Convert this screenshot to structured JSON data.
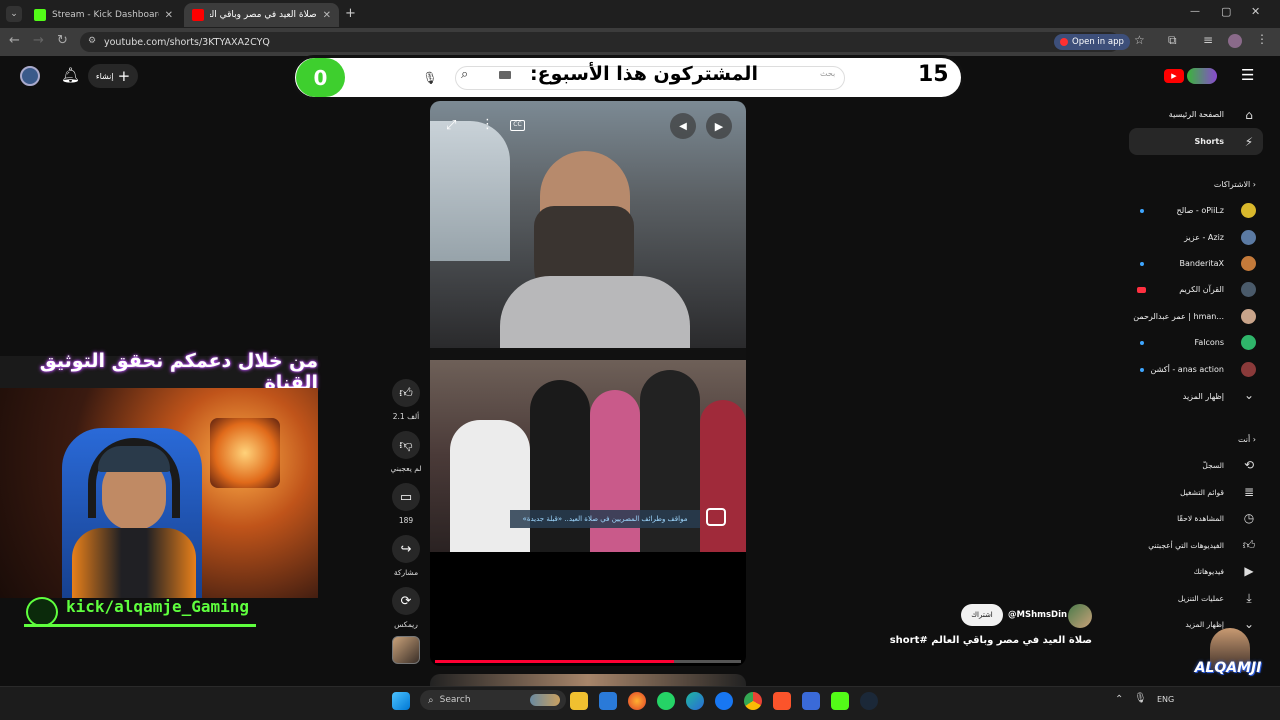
{
  "browser": {
    "tabs": [
      {
        "title": "Stream - Kick Dashboard",
        "active": false,
        "favicon_color": "#53fc18"
      },
      {
        "title": "صلاة العيد في مصر وباقي العالم",
        "active": true,
        "favicon_color": "#ff0000"
      }
    ],
    "url": "youtube.com/shorts/3KTYAXA2CYQ",
    "open_in_app": "Open in app",
    "window_controls": [
      "—",
      "▢",
      "✕"
    ]
  },
  "youtube": {
    "search_placeholder": "بحث",
    "create_label": "إنشاء",
    "sidebar": {
      "main": [
        {
          "label": "الصفحة الرئيسية",
          "icon": "home-icon"
        },
        {
          "label": "Shorts",
          "icon": "shorts-icon",
          "active": true
        }
      ],
      "subscriptions_header": "الاشتراكات",
      "subscriptions": [
        {
          "label": "صالح - oPiiLz",
          "dot": true,
          "avatar_color": "#d9b82c"
        },
        {
          "label": "عزيز - Aziz",
          "dot": false,
          "avatar_color": "#5b7aa3"
        },
        {
          "label": "BanderitaX",
          "dot": true,
          "avatar_color": "#c47a3a"
        },
        {
          "label": "القرآن الكريم",
          "dot": false,
          "live": true,
          "avatar_color": "#4a5a6a"
        },
        {
          "label": "عمر عبدالرحمن | hman...",
          "dot": false,
          "avatar_color": "#c9a48a"
        },
        {
          "label": "Falcons",
          "dot": true,
          "avatar_color": "#2fb56a"
        },
        {
          "label": "أكشن - anas action",
          "dot": true,
          "avatar_color": "#8a3a3a"
        }
      ],
      "show_more": "إظهار المزيد",
      "you_header": "أنت",
      "you": [
        {
          "label": "السجلّ",
          "icon": "history-icon"
        },
        {
          "label": "قوائم التشغيل",
          "icon": "playlists-icon"
        },
        {
          "label": "المشاهدة لاحقًا",
          "icon": "watch-later-icon"
        },
        {
          "label": "الفيديوهات التي أعجبتني",
          "icon": "liked-icon"
        },
        {
          "label": "فيديوهاتك",
          "icon": "your-videos-icon"
        },
        {
          "label": "عمليات التنزيل",
          "icon": "download-icon"
        },
        {
          "label": "إظهار المزيد",
          "icon": "chevron-down-icon"
        }
      ]
    },
    "actions": {
      "likes": "2.1 ألف",
      "dislike": "لم يعجبني",
      "comments": "189",
      "share": "مشاركة",
      "remix": "ريمكس"
    },
    "short": {
      "channel": "@MShmsDin",
      "subscribe": "اشتراك",
      "title": "صلاة العيد في مصر وباقي العالم #short",
      "caption": "مواقف وطرائف المصريين في صلاة العيد.. «قبلة جديدة»",
      "progress": 0.78
    }
  },
  "overlay": {
    "left_count": "0",
    "title": "المشتركون هذا الأسبوع:",
    "right_count": "15",
    "banner": "من خلال دعمكم نحقق التوثيق القناة",
    "kick_handle": "kick/alqamje_Gaming",
    "logo_text": "ALQAMJI"
  },
  "taskbar": {
    "search": "Search",
    "lang": "ENG"
  }
}
